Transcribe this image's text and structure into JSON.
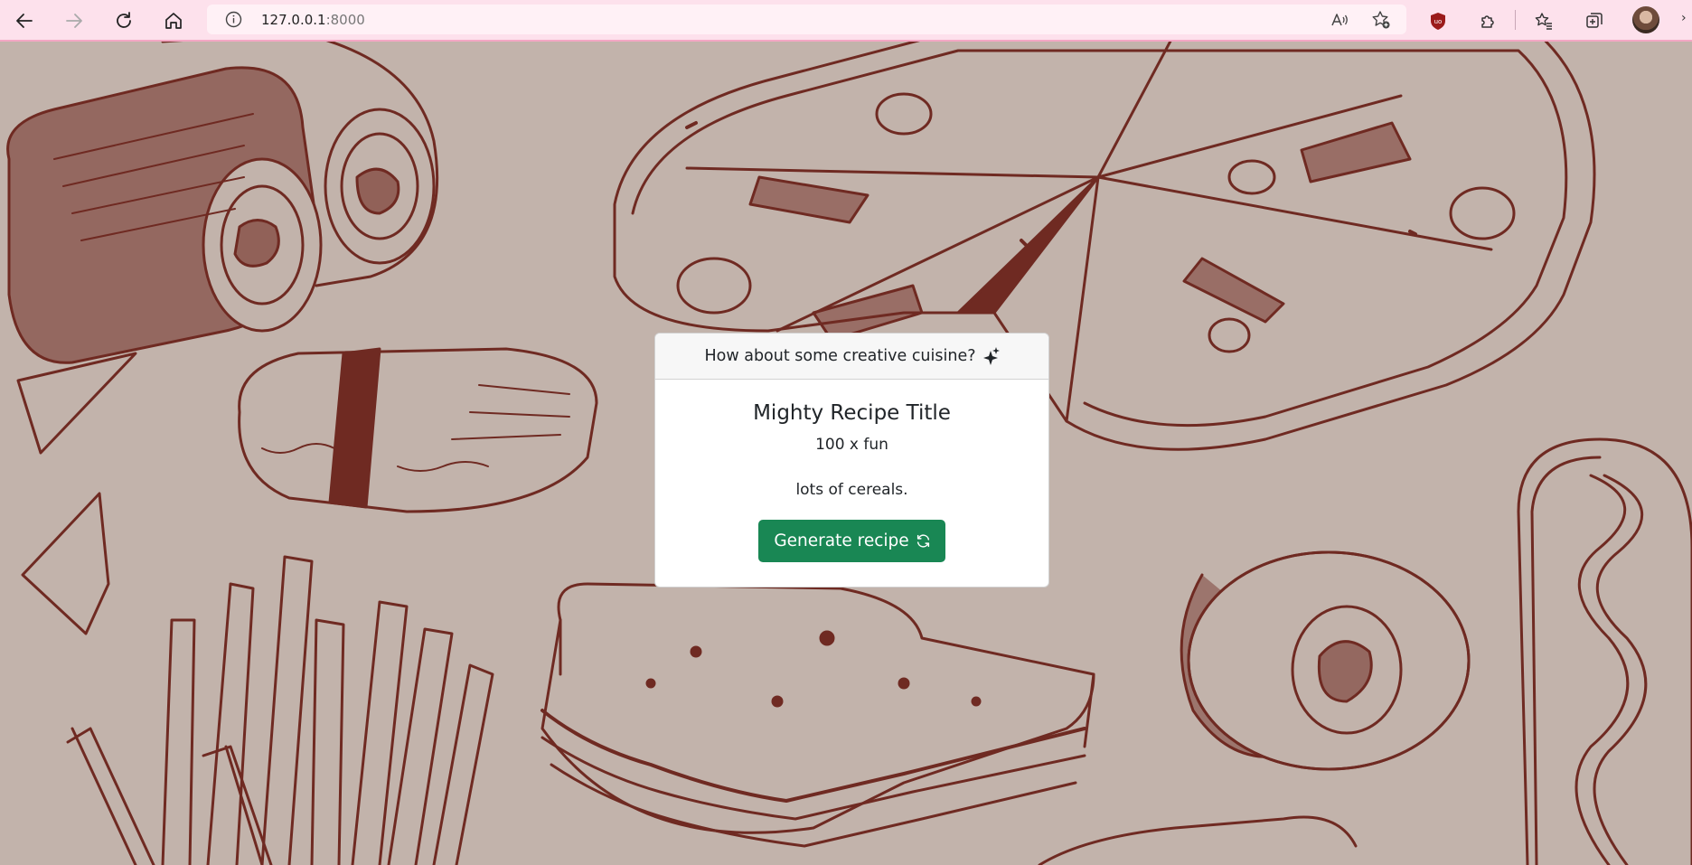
{
  "browser": {
    "url_host": "127.0.0.1",
    "url_port": ":8000",
    "icons": {
      "back": "arrow-left-icon",
      "forward": "arrow-right-icon",
      "refresh": "refresh-icon",
      "home": "home-icon",
      "site_info": "info-icon",
      "read_aloud": "read-aloud-icon",
      "favorite": "star-add-icon",
      "ublock": "ublock-shield-icon",
      "extensions": "puzzle-icon",
      "favorites": "favorites-list-icon",
      "collections": "collections-icon",
      "profile": "avatar"
    },
    "accent_color": "#fde1ec"
  },
  "page": {
    "background_color": "#c2b3ab",
    "illustration_color": "#6f2a22",
    "card": {
      "header_text": "How about some creative cuisine?",
      "header_icon": "sparkles-icon",
      "title": "Mighty Recipe Title",
      "ingredient": "100 x fun",
      "instructions": "lots of cereals.",
      "button_label": "Generate recipe",
      "button_icon": "refresh-icon",
      "button_color": "#198754"
    }
  }
}
